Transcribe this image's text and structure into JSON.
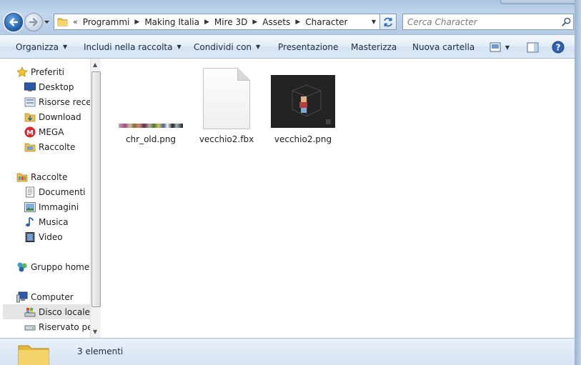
{
  "window": {
    "breadcrumb_prefix": "«",
    "breadcrumbs": [
      "Programmi",
      "Making Italia",
      "Mire 3D",
      "Assets",
      "Character"
    ],
    "search_placeholder": "Cerca Character"
  },
  "toolbar": {
    "items": [
      {
        "label": "Organizza",
        "has_dropdown": true
      },
      {
        "label": "Includi nella raccolta",
        "has_dropdown": true
      },
      {
        "label": "Condividi con",
        "has_dropdown": true
      },
      {
        "label": "Presentazione",
        "has_dropdown": false
      },
      {
        "label": "Masterizza",
        "has_dropdown": false
      },
      {
        "label": "Nuova cartella",
        "has_dropdown": false
      }
    ],
    "icons": [
      "view-icon",
      "preview-pane-icon",
      "help-icon"
    ]
  },
  "navigation": {
    "favorites": {
      "label": "Preferiti",
      "icon": "star-icon"
    },
    "favorites_items": [
      {
        "label": "Desktop",
        "icon": "desktop-icon"
      },
      {
        "label": "Risorse recen",
        "icon": "recent-places-icon"
      },
      {
        "label": "Download",
        "icon": "download-folder-icon"
      },
      {
        "label": "MEGA",
        "icon": "mega-icon"
      },
      {
        "label": "Raccolte",
        "icon": "libraries-folder-icon"
      }
    ],
    "libraries": {
      "label": "Raccolte",
      "icon": "libraries-icon"
    },
    "libraries_items": [
      {
        "label": "Documenti",
        "icon": "documents-icon"
      },
      {
        "label": "Immagini",
        "icon": "pictures-icon"
      },
      {
        "label": "Musica",
        "icon": "music-icon"
      },
      {
        "label": "Video",
        "icon": "video-icon"
      }
    ],
    "homegroup": {
      "label": "Gruppo home",
      "icon": "homegroup-icon"
    },
    "computer": {
      "label": "Computer",
      "icon": "computer-icon"
    },
    "computer_items": [
      {
        "label": "Disco locale (",
        "icon": "local-disk-icon",
        "selected": true
      },
      {
        "label": "Riservato per",
        "icon": "drive-icon",
        "selected": false
      }
    ]
  },
  "files": [
    {
      "name": "chr_old.png",
      "type": "image-strip"
    },
    {
      "name": "vecchio2.fbx",
      "type": "document"
    },
    {
      "name": "vecchio2.png",
      "type": "image-dark"
    }
  ],
  "status": {
    "count_text": "3 elementi"
  }
}
